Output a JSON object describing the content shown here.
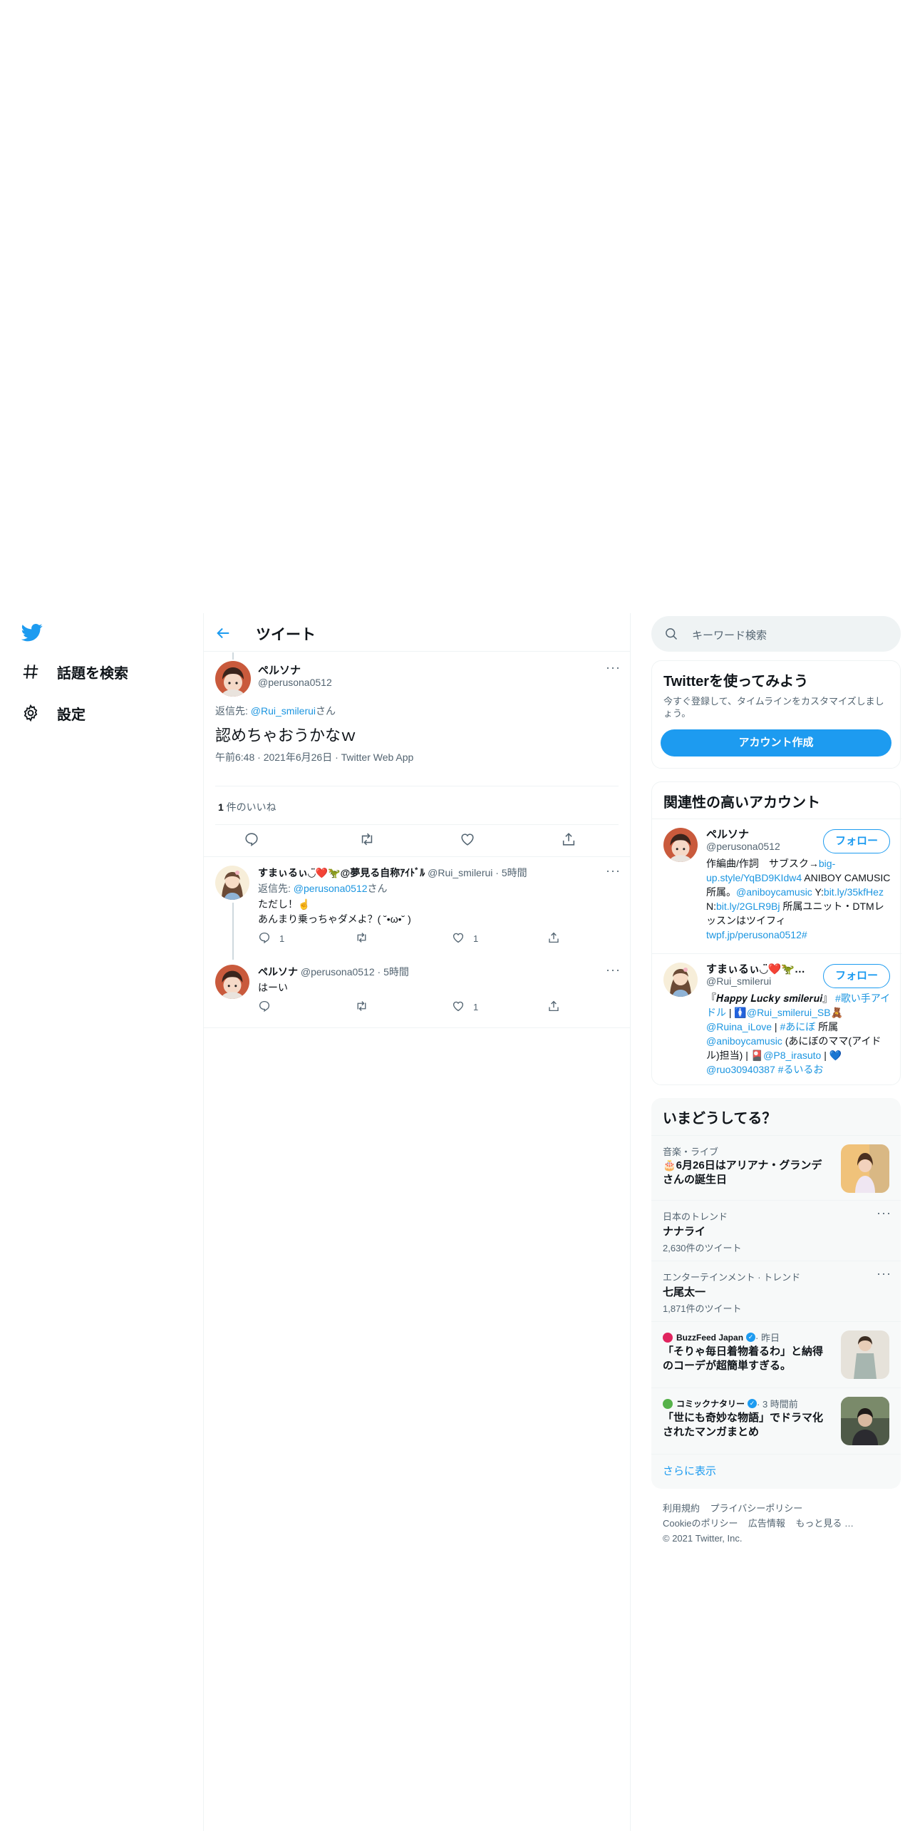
{
  "nav": {
    "logo_icon": "twitter-bird-icon",
    "explore_label": "話題を検索",
    "settings_label": "設定"
  },
  "main": {
    "header_title": "ツイート",
    "tweet": {
      "display_name": "ペルソナ",
      "handle": "@perusona0512",
      "reply_prefix": "返信先: ",
      "reply_to": "@Rui_smilerui",
      "reply_suffix": "さん",
      "text": "認めちゃおうかなｗ",
      "meta": "午前6:48 · 2021年6月26日 · Twitter Web App",
      "likes_count": "1",
      "likes_label": " 件のいいね"
    },
    "replies": [
      {
        "display_name": "すまぃるぃ◡̈❤️🦖@夢見る自称ｱｲﾄﾞﾙ",
        "handle": "@Rui_smilerui",
        "time": " · 5時間",
        "reply_prefix": "返信先: ",
        "reply_to": "@perusona0512",
        "reply_suffix": "さん",
        "line1": "ただし！☝️",
        "line2": "あんまり乗っちゃダメよ？( ˘•ω•˘ )",
        "reply_count": "1",
        "retweet_count": "",
        "like_count": "1"
      },
      {
        "display_name": "ペルソナ",
        "handle": "@perusona0512",
        "time": " · 5時間",
        "text": "はーい",
        "reply_count": "",
        "retweet_count": "",
        "like_count": "1"
      }
    ]
  },
  "sidebar": {
    "search_placeholder": "キーワード検索",
    "signup": {
      "title": "Twitterを使ってみよう",
      "desc": "今すぐ登録して、タイムラインをカスタマイズしましょう。",
      "button": "アカウント作成"
    },
    "related": {
      "title": "関連性の高いアカウント",
      "follow_label": "フォロー",
      "accounts": [
        {
          "name": "ペルソナ",
          "handle": "@perusona0512",
          "bio_1a": "作編曲/作詞　サブスク→",
          "bio_1b": "big-up.style/YqBD9KIdw4",
          "bio_2a": " ANIBOY CAMUSIC所属。",
          "bio_2b": "@aniboycamusic",
          "bio_3a": " Y:",
          "bio_3b": "bit.ly/35kfHez",
          "bio_3c": " N:",
          "bio_3d": "bit.ly/2GLR9Bj",
          "bio_4": " 所属ユニット・DTMレッスンはツイフィ",
          "bio_5": "twpf.jp/perusona0512#"
        },
        {
          "name": "すまぃるぃ◡̈❤️🦖…",
          "handle": "@Rui_smilerui",
          "bio_1a": "『𝑯𝒂𝒑𝒑𝒚 𝑳𝒖𝒄𝒌𝒚 𝒔𝒎𝒊𝒍𝒆𝒓𝒖𝒊』 ",
          "bio_1b": "#歌い手アイドル",
          "bio_2a": " | 🚺",
          "bio_2b": "@Rui_smilerui_SB",
          "bio_2c": "🧸",
          "bio_3a": "@Ruina_iLove",
          "bio_3b": " | ",
          "bio_3c": "#あにぼ",
          "bio_3d": " 所属",
          "bio_4a": "@aniboycamusic",
          "bio_4b": " (あにぼのママ(アイドル)担当) | 🎴",
          "bio_4c": "@P8_irasuto",
          "bio_4d": " | 💙",
          "bio_5a": "@ruo30940387",
          "bio_5b": " #るいるお"
        }
      ]
    },
    "trends": {
      "title": "いまどうしてる？",
      "items": [
        {
          "context": "音楽・ライブ",
          "name": "🎂6月26日はアリアナ・グランデさんの誕生日"
        },
        {
          "context": "日本のトレンド",
          "name": "ナナライ",
          "count": "2,630件のツイート"
        },
        {
          "context": "エンターテインメント · トレンド",
          "name": "七尾太一",
          "count": "1,871件のツイート"
        },
        {
          "source": "BuzzFeed Japan",
          "time": " · 昨日",
          "name": "「そりゃ毎日着物着るわ」と納得のコーデが超簡単すぎる。"
        },
        {
          "source": "コミックナタリー",
          "time": " · 3 時間前",
          "name": "「世にも奇妙な物語」でドラマ化されたマンガまとめ"
        }
      ],
      "show_more": "さらに表示"
    },
    "footer": {
      "terms": "利用規約",
      "privacy": "プライバシーポリシー",
      "cookie": "Cookieのポリシー",
      "ads": "広告情報",
      "more": "もっと見る …",
      "copyright": "© 2021 Twitter, Inc."
    }
  },
  "colors": {
    "accent": "#1d9bf0",
    "link": "#1b95e0",
    "text": "#0f1419",
    "secondary": "#536471",
    "border": "#eff3f4"
  }
}
